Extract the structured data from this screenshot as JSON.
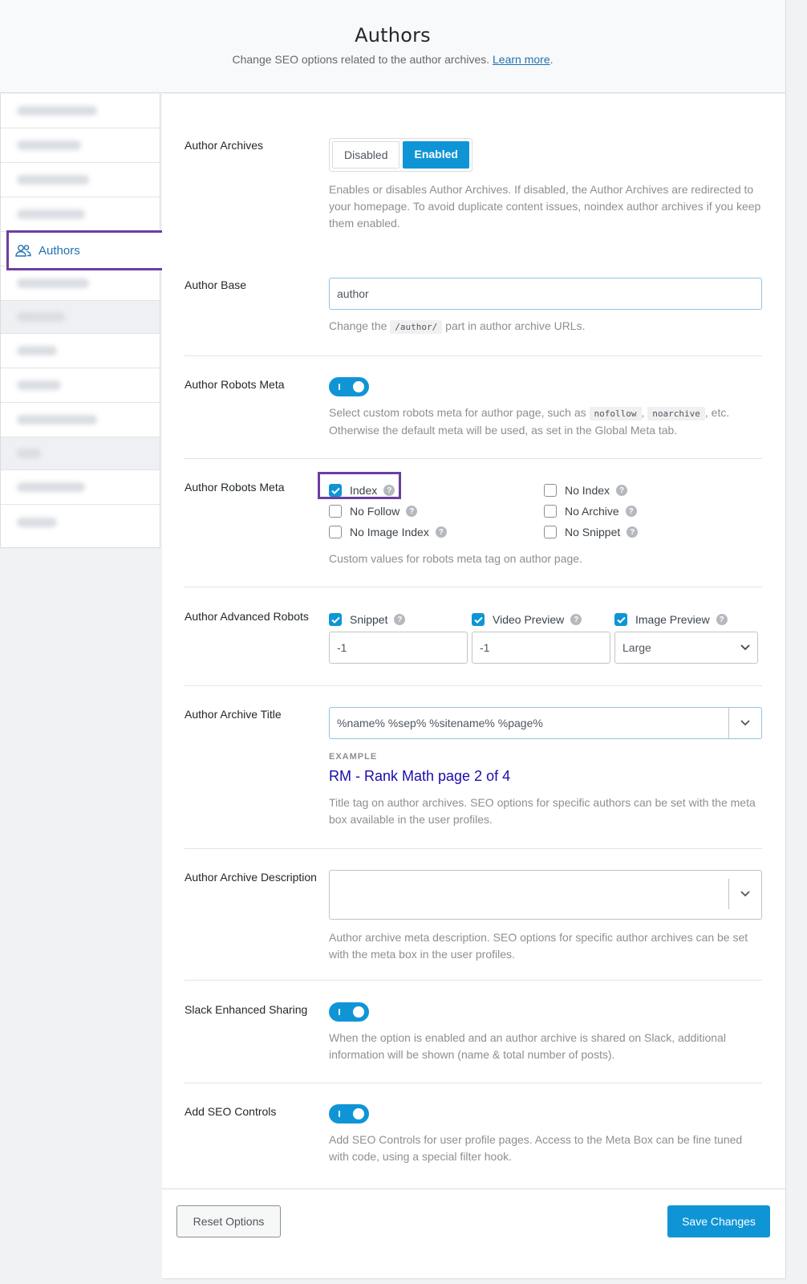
{
  "header": {
    "title": "Authors",
    "subtitle": "Change SEO options related to the author archives.",
    "learn_more": "Learn more"
  },
  "sidebar": {
    "active_label": "Authors"
  },
  "author_archives": {
    "label": "Author Archives",
    "disabled": "Disabled",
    "enabled": "Enabled",
    "desc": "Enables or disables Author Archives. If disabled, the Author Archives are redirected to your homepage. To avoid duplicate content issues, noindex author archives if you keep them enabled."
  },
  "author_base": {
    "label": "Author Base",
    "value": "author",
    "desc_pre": "Change the",
    "desc_code": "/author/",
    "desc_post": "part in author archive URLs."
  },
  "robots_toggle": {
    "label": "Author Robots Meta",
    "desc_pre": "Select custom robots meta for author page, such as",
    "code1": "nofollow",
    "code2": "noarchive",
    "desc_post": ", etc. Otherwise the default meta will be used, as set in the Global Meta tab."
  },
  "robots_meta": {
    "label": "Author Robots Meta",
    "index": "Index",
    "no_index": "No Index",
    "no_follow": "No Follow",
    "no_archive": "No Archive",
    "no_image_index": "No Image Index",
    "no_snippet": "No Snippet",
    "desc": "Custom values for robots meta tag on author page."
  },
  "advanced_robots": {
    "label": "Author Advanced Robots",
    "snippet": "Snippet",
    "video_preview": "Video Preview",
    "image_preview": "Image Preview",
    "snippet_value": "-1",
    "video_value": "-1",
    "image_value": "Large"
  },
  "archive_title": {
    "label": "Author Archive Title",
    "value": "%name% %sep% %sitename% %page%",
    "example_label": "EXAMPLE",
    "example": "RM - Rank Math page 2 of 4",
    "desc": "Title tag on author archives. SEO options for specific authors can be set with the meta box available in the user profiles."
  },
  "archive_description": {
    "label": "Author Archive Description",
    "value": "",
    "desc": "Author archive meta description. SEO options for specific author archives can be set with the meta box in the user profiles."
  },
  "slack": {
    "label": "Slack Enhanced Sharing",
    "desc": "When the option is enabled and an author archive is shared on Slack, additional information will be shown (name & total number of posts)."
  },
  "seo_controls": {
    "label": "Add SEO Controls",
    "desc": "Add SEO Controls for user profile pages. Access to the Meta Box can be fine tuned with code, using a special filter hook."
  },
  "footer": {
    "reset": "Reset Options",
    "save": "Save Changes"
  },
  "colors": {
    "accent": "#0f95d6",
    "highlight": "#6b3fa0",
    "link": "#2271b1",
    "example_link": "#1a0dab"
  }
}
